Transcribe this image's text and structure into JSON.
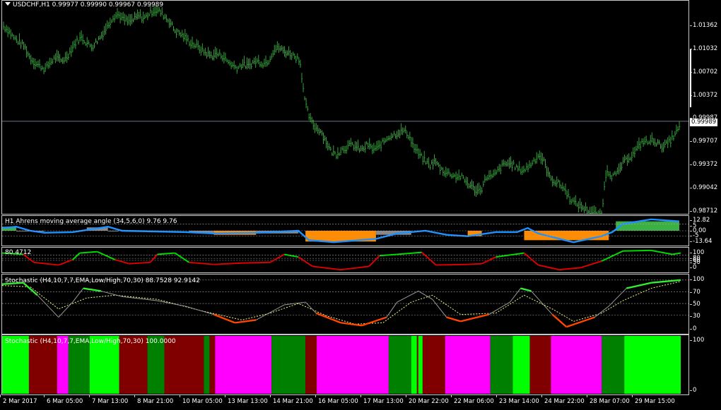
{
  "main": {
    "label": "USDCHF,H1  0.99977 0.99990 0.99967 0.99989",
    "price_axis": [
      "1.01362",
      "1.01032",
      "1.00702",
      "1.00372",
      "0.99987",
      "0.99707",
      "0.99372",
      "0.99042",
      "0.98712"
    ],
    "current_price": "0.99989",
    "close_series": [
      1.0135,
      1.0128,
      1.0118,
      1.0112,
      1.0106,
      1.0091,
      1.0082,
      1.0078,
      1.0073,
      1.0083,
      1.009,
      1.0085,
      1.0089,
      1.0101,
      1.0113,
      1.0119,
      1.0111,
      1.0105,
      1.0114,
      1.0123,
      1.0135,
      1.0148,
      1.0152,
      1.0145,
      1.0141,
      1.0144,
      1.015,
      1.0146,
      1.0153,
      1.0158,
      1.0156,
      1.0149,
      1.0141,
      1.0128,
      1.0124,
      1.0118,
      1.0111,
      1.0107,
      1.0101,
      1.0096,
      1.0092,
      1.0095,
      1.0093,
      1.0085,
      1.0079,
      1.0075,
      1.0081,
      1.0077,
      1.0083,
      1.0085,
      1.0081,
      1.0086,
      1.0101,
      1.0104,
      1.0098,
      1.0096,
      1.0092,
      1.0087,
      1.0025,
      1.0,
      0.9989,
      0.9985,
      0.997,
      0.9955,
      0.9951,
      0.9958,
      0.9961,
      0.9965,
      0.996,
      0.9957,
      0.9965,
      0.9958,
      0.996,
      0.9968,
      0.9976,
      0.9979,
      0.9982,
      0.9985,
      0.9978,
      0.996,
      0.995,
      0.9942,
      0.9935,
      0.9941,
      0.9931,
      0.9925,
      0.9923,
      0.9919,
      0.9919,
      0.9911,
      0.9905,
      0.9898,
      0.9902,
      0.992,
      0.9918,
      0.9926,
      0.9935,
      0.9938,
      0.9936,
      0.993,
      0.9928,
      0.9933,
      0.9942,
      0.995,
      0.994,
      0.9918,
      0.9912,
      0.9908,
      0.99,
      0.9887,
      0.988,
      0.9876,
      0.9872,
      0.9868,
      0.9865,
      0.9864,
      0.993,
      0.992,
      0.9922,
      0.9936,
      0.9945,
      0.995,
      0.996,
      0.997,
      0.9968,
      0.9972,
      0.9965,
      0.9962,
      0.9968,
      0.9978,
      0.9989
    ]
  },
  "ahrens": {
    "label": "H1 Ahrens moving average angle (34,5,6,0) 9.76 9.76",
    "axis": [
      "12.82",
      "5",
      "0.00",
      "-5",
      "-13.64"
    ]
  },
  "osc1": {
    "label": "80.4712",
    "axis": [
      "100",
      "80",
      "60",
      "50",
      "0"
    ]
  },
  "stoch1": {
    "label": "Stochastic (H4,10,7,7,EMA,Low/High,70,30) 88.7528 92.9142",
    "axis": [
      "100",
      "70",
      "50",
      "30",
      "0"
    ]
  },
  "stoch2": {
    "label": "Stochastic (H4,10,7,7,EMA,Low/High,70,30) 100.0000",
    "axis": [
      "100",
      "0"
    ],
    "colors": {
      "bright_green": "#00ff00",
      "green": "#008000",
      "maroon": "#800000",
      "magenta": "#ff00ff"
    }
  },
  "time_axis": [
    "2 Mar 2017",
    "6 Mar 05:00",
    "7 Mar 13:00",
    "8 Mar 21:00",
    "10 Mar 05:00",
    "13 Mar 13:00",
    "14 Mar 21:00",
    "16 Mar 05:00",
    "17 Mar 13:00",
    "20 Mar 22:00",
    "22 Mar 06:00",
    "23 Mar 14:00",
    "24 Mar 22:00",
    "28 Mar 07:00",
    "29 Mar 15:00"
  ],
  "icons": {
    "menu": "dropdown-triangle-icon"
  }
}
